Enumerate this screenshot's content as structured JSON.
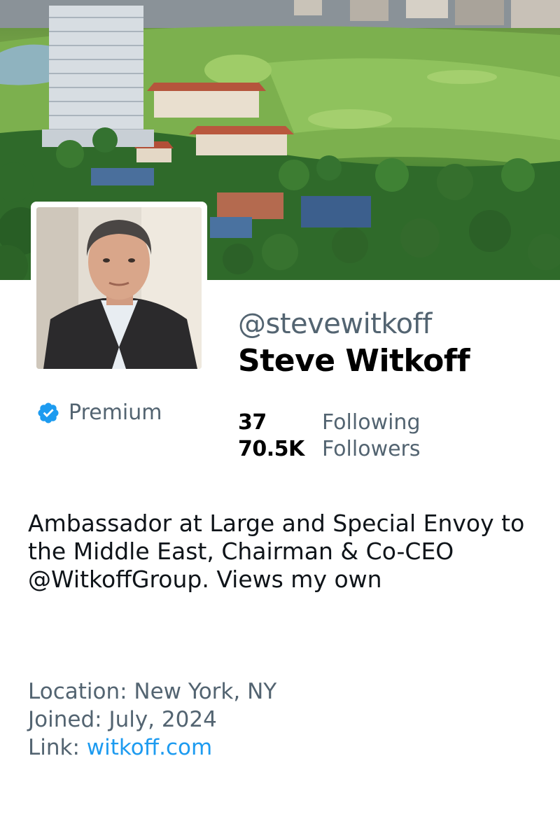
{
  "banner": {
    "description_icon": "banner-photo"
  },
  "profile": {
    "handle": "@stevewitkoff",
    "display_name": "Steve Witkoff",
    "premium_label": "Premium",
    "premium_icon": "verified-badge-icon",
    "accent_color": "#1d9bf0"
  },
  "stats": {
    "following_count": "37",
    "following_label": "Following",
    "followers_count": "70.5K",
    "followers_label": "Followers"
  },
  "bio": "Ambassador at Large and Special Envoy to the Middle East, Chairman & Co-CEO @WitkoffGroup. Views my own",
  "meta": {
    "location_label": "Location:",
    "location_value": "New York, NY",
    "joined_label": "Joined:",
    "joined_value": "July, 2024",
    "link_label": "Link:",
    "link_value": "witkoff.com"
  }
}
